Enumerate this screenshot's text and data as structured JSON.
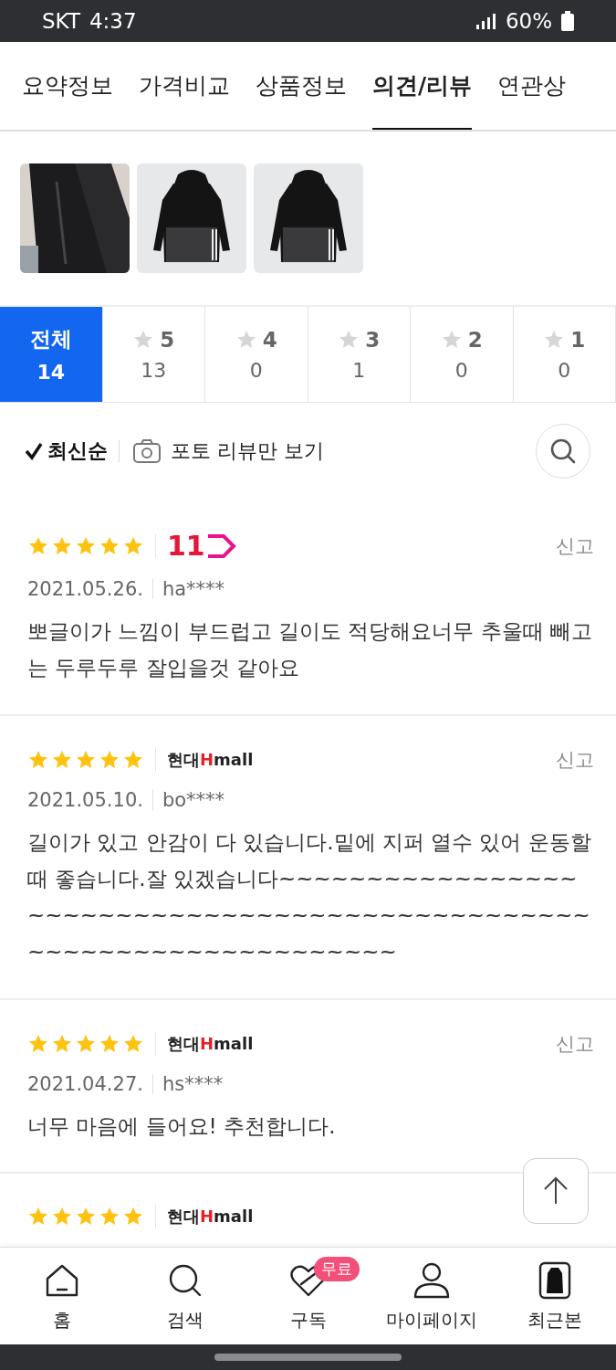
{
  "status_bar": {
    "carrier": "SKT",
    "time": "4:37",
    "battery": "60%"
  },
  "tabs": [
    {
      "label": "요약정보",
      "selected": false
    },
    {
      "label": "가격비교",
      "selected": false
    },
    {
      "label": "상품정보",
      "selected": false
    },
    {
      "label": "의견/리뷰",
      "selected": true
    },
    {
      "label": "연관상",
      "selected": false
    }
  ],
  "rating_filter": [
    {
      "kind": "all",
      "label": "전체",
      "count": "14",
      "selected": true
    },
    {
      "kind": "star",
      "label": "5",
      "count": "13",
      "selected": false
    },
    {
      "kind": "star",
      "label": "4",
      "count": "0",
      "selected": false
    },
    {
      "kind": "star",
      "label": "3",
      "count": "1",
      "selected": false
    },
    {
      "kind": "star",
      "label": "2",
      "count": "0",
      "selected": false
    },
    {
      "kind": "star",
      "label": "1",
      "count": "0",
      "selected": false
    }
  ],
  "sort": {
    "label": "최신순",
    "checked": true
  },
  "photo_filter": {
    "label": "포토 리뷰만 보기"
  },
  "reviews": [
    {
      "stars": 5,
      "store": {
        "kind": "elevenst",
        "parts": [
          "11"
        ]
      },
      "report": "신고",
      "date": "2021.05.26.",
      "user": "ha****",
      "text": "뽀글이가 느낌이 부드럽고 길이도 적당해요너무 추울때 빼고는 두루두루 잘입을것 같아요"
    },
    {
      "stars": 5,
      "store": {
        "kind": "hmall",
        "parts": [
          "현대",
          "H",
          "mall"
        ]
      },
      "report": "신고",
      "date": "2021.05.10.",
      "user": "bo****",
      "text": "길이가 있고 안감이 다 있습니다.밑에 지퍼 열수 있어 운동할 때 좋습니다.잘 있겠습니다~~~~~~~~~~~~~~~~~~~~~~~~~~~~~~~~~~~~~~~~~~~~~~~~~~~~~~~~~~~~~~~~~~~~~~"
    },
    {
      "stars": 5,
      "store": {
        "kind": "hmall",
        "parts": [
          "현대",
          "H",
          "mall"
        ]
      },
      "report": "신고",
      "date": "2021.04.27.",
      "user": "hs****",
      "text": "너무 마음에 들어요! 추천합니다."
    },
    {
      "stars": 5,
      "store": {
        "kind": "hmall",
        "parts": [
          "현대",
          "H",
          "mall"
        ]
      }
    }
  ],
  "bottom_nav": [
    {
      "kind": "home",
      "label": "홈"
    },
    {
      "kind": "search",
      "label": "검색"
    },
    {
      "kind": "subscribe",
      "label": "구독",
      "badge": "무료"
    },
    {
      "kind": "person",
      "label": "마이페이지"
    },
    {
      "kind": "recent",
      "label": "최근본"
    }
  ]
}
